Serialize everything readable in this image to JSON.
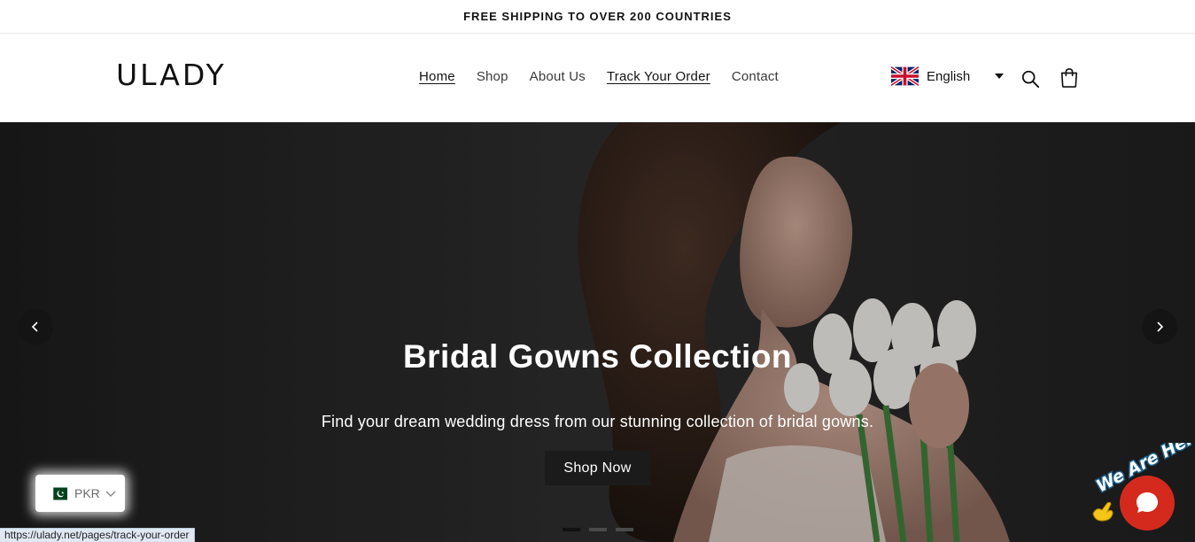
{
  "announcement": {
    "text": "FREE SHIPPING TO OVER 200 COUNTRIES"
  },
  "header": {
    "logo": "ULADY",
    "nav": [
      {
        "label": "Home",
        "active": true
      },
      {
        "label": "Shop"
      },
      {
        "label": "About Us"
      },
      {
        "label": "Track Your Order",
        "underlined": true
      },
      {
        "label": "Contact"
      }
    ],
    "language": {
      "label": "English",
      "flag_icon": "uk-flag-icon"
    },
    "icons": {
      "search": "search-icon",
      "cart": "cart-icon"
    }
  },
  "hero": {
    "title": "Bridal Gowns Collection",
    "subtitle": "Find your dream wedding dress from our stunning collection of bridal gowns.",
    "button_label": "Shop Now",
    "slides": 3,
    "active_slide": 1
  },
  "currency": {
    "code": "PKR",
    "flag_icon": "pakistan-flag-icon"
  },
  "status_bar": {
    "url": "https://ulady.net/pages/track-your-order"
  },
  "chat": {
    "badge_text": "We Are Here!",
    "colors": {
      "button": "#d42a1e"
    }
  }
}
